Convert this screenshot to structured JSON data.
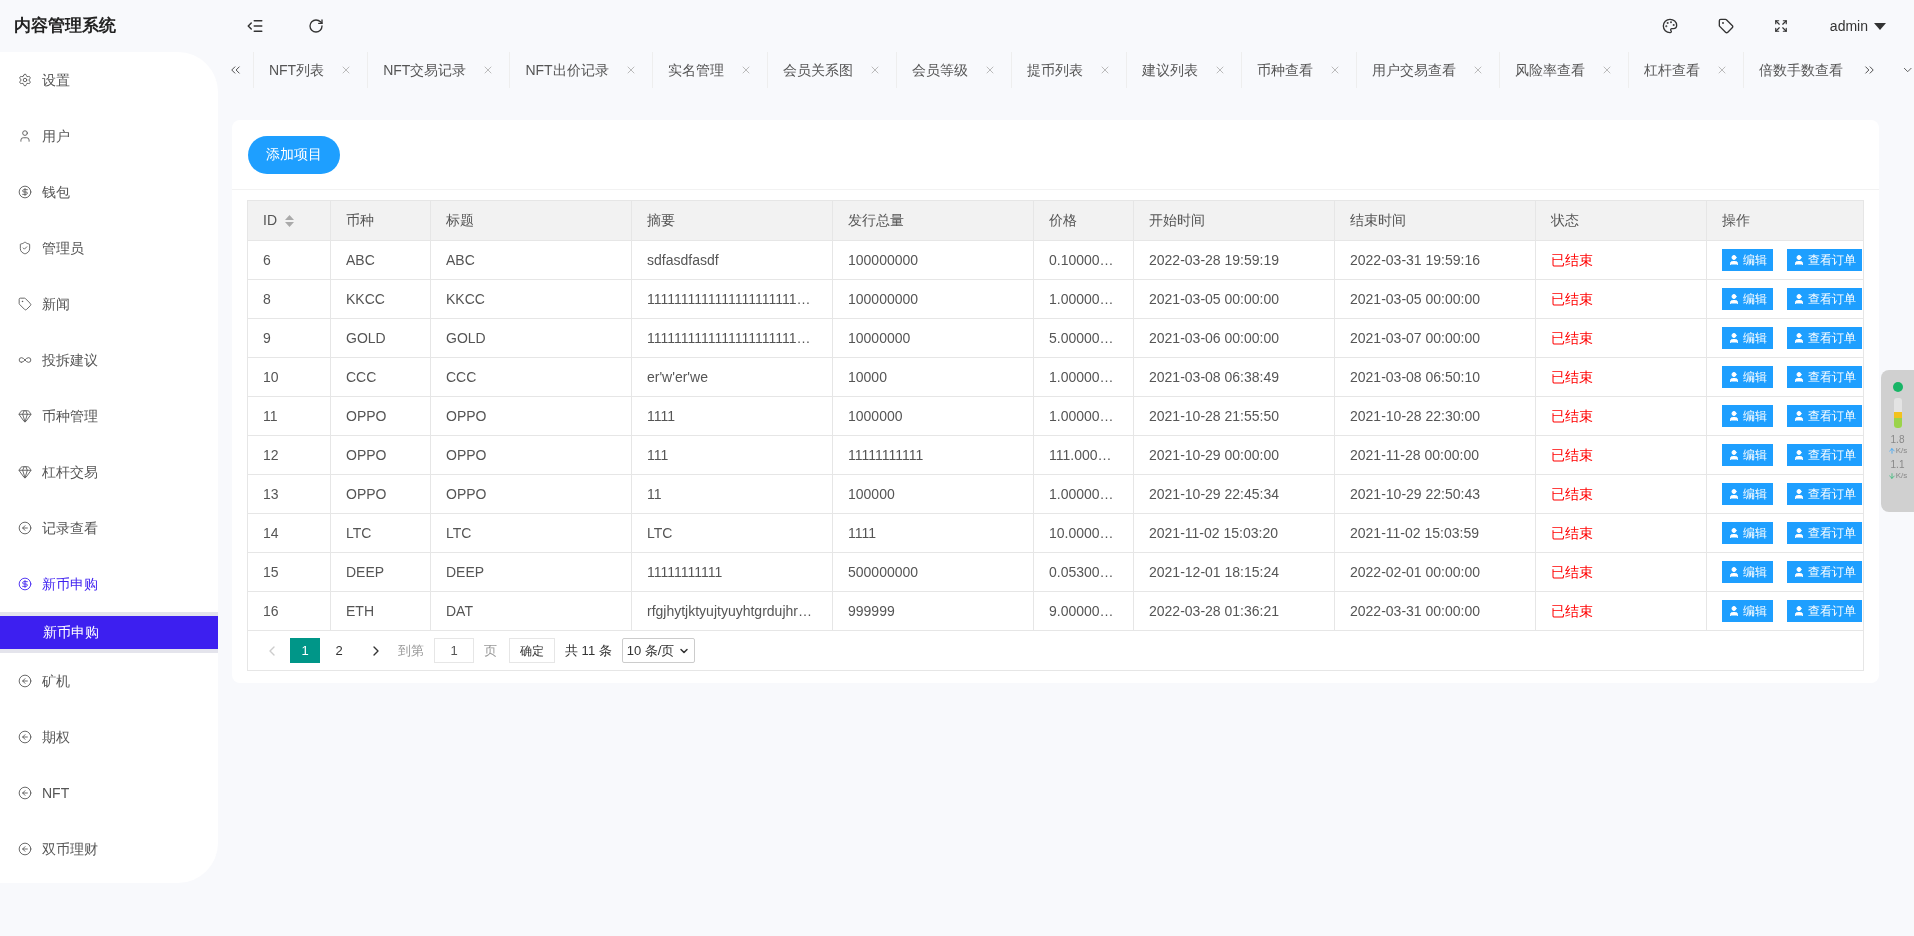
{
  "app_title": "内容管理系统",
  "user": {
    "name": "admin"
  },
  "sidebar": {
    "items": [
      {
        "label": "设置",
        "selected": false
      },
      {
        "label": "用户",
        "selected": false
      },
      {
        "label": "钱包",
        "selected": false
      },
      {
        "label": "管理员",
        "selected": false
      },
      {
        "label": "新闻",
        "selected": false
      },
      {
        "label": "投拆建议",
        "selected": false
      },
      {
        "label": "币种管理",
        "selected": false
      },
      {
        "label": "杠杆交易",
        "selected": false
      },
      {
        "label": "记录查看",
        "selected": false
      },
      {
        "label": "新币申购",
        "selected": true,
        "children": [
          {
            "label": "新币申购",
            "selected": true
          }
        ]
      },
      {
        "label": "矿机",
        "selected": false
      },
      {
        "label": "期权",
        "selected": false
      },
      {
        "label": "NFT",
        "selected": false
      },
      {
        "label": "双币理财",
        "selected": false
      }
    ]
  },
  "tabs": [
    {
      "label": "NFT列表"
    },
    {
      "label": "NFT交易记录"
    },
    {
      "label": "NFT出价记录"
    },
    {
      "label": "实名管理"
    },
    {
      "label": "会员关系图"
    },
    {
      "label": "会员等级"
    },
    {
      "label": "提币列表"
    },
    {
      "label": "建议列表"
    },
    {
      "label": "币种查看"
    },
    {
      "label": "用户交易查看"
    },
    {
      "label": "风险率查看"
    },
    {
      "label": "杠杆查看"
    },
    {
      "label": "倍数手数查看",
      "closable": false
    }
  ],
  "add_button": "添加项目",
  "table": {
    "columns": [
      "ID",
      "币种",
      "标题",
      "摘要",
      "发行总量",
      "价格",
      "开始时间",
      "结束时间",
      "状态",
      "操作"
    ],
    "rows": [
      {
        "cells": [
          "6",
          "ABC",
          "ABC",
          "sdfasdfasdf",
          "100000000",
          "0.10000…",
          "2022-03-28 19:59:19",
          "2022-03-31 19:59:16",
          "已结束"
        ],
        "actions": [
          "编辑",
          "查看订单"
        ]
      },
      {
        "cells": [
          "8",
          "KKCC",
          "KKCC",
          "1111111111111111111111…",
          "100000000",
          "1.00000…",
          "2021-03-05 00:00:00",
          "2021-03-05 00:00:00",
          "已结束"
        ],
        "actions": [
          "编辑",
          "查看订单"
        ]
      },
      {
        "cells": [
          "9",
          "GOLD",
          "GOLD",
          "1111111111111111111111…",
          "10000000",
          "5.00000…",
          "2021-03-06 00:00:00",
          "2021-03-07 00:00:00",
          "已结束"
        ],
        "actions": [
          "编辑",
          "查看订单"
        ]
      },
      {
        "cells": [
          "10",
          "CCC",
          "CCC",
          "er'w'er'we",
          "10000",
          "1.00000…",
          "2021-03-08 06:38:49",
          "2021-03-08 06:50:10",
          "已结束"
        ],
        "actions": [
          "编辑",
          "查看订单"
        ]
      },
      {
        "cells": [
          "11",
          "OPPO",
          "OPPO",
          "1111",
          "1000000",
          "1.00000…",
          "2021-10-28 21:55:50",
          "2021-10-28 22:30:00",
          "已结束"
        ],
        "actions": [
          "编辑",
          "查看订单"
        ]
      },
      {
        "cells": [
          "12",
          "OPPO",
          "OPPO",
          "111",
          "11111111111",
          "111.000…",
          "2021-10-29 00:00:00",
          "2021-11-28 00:00:00",
          "已结束"
        ],
        "actions": [
          "编辑",
          "查看订单"
        ]
      },
      {
        "cells": [
          "13",
          "OPPO",
          "OPPO",
          "11",
          "100000",
          "1.00000…",
          "2021-10-29 22:45:34",
          "2021-10-29 22:50:43",
          "已结束"
        ],
        "actions": [
          "编辑",
          "查看订单"
        ]
      },
      {
        "cells": [
          "14",
          "LTC",
          "LTC",
          "LTC",
          "1111",
          "10.0000…",
          "2021-11-02 15:03:20",
          "2021-11-02 15:03:59",
          "已结束"
        ],
        "actions": [
          "编辑",
          "查看订单"
        ]
      },
      {
        "cells": [
          "15",
          "DEEP",
          "DEEP",
          "11111111111",
          "500000000",
          "0.05300…",
          "2021-12-01 18:15:24",
          "2022-02-01 00:00:00",
          "已结束"
        ],
        "actions": [
          "编辑",
          "查看订单"
        ]
      },
      {
        "cells": [
          "16",
          "ETH",
          "DAT",
          "rfgjhytjktyujtyuyhtgrdujhr…",
          "999999",
          "9.00000…",
          "2022-03-28 01:36:21",
          "2022-03-31 00:00:00",
          "已结束"
        ],
        "actions": [
          "编辑",
          "查看订单"
        ]
      }
    ]
  },
  "pagination": {
    "pages": [
      {
        "label": "1",
        "selected": true
      },
      {
        "label": "2",
        "selected": false
      }
    ],
    "goto_label": "到第",
    "page_value": "1",
    "page_unit": "页",
    "confirm": "确定",
    "total": "共 11 条",
    "page_size": "10 条/页"
  },
  "speed_widget": {
    "upload": "1.8",
    "upload_unit": "K/s",
    "download": "1.1",
    "download_unit": "K/s"
  }
}
